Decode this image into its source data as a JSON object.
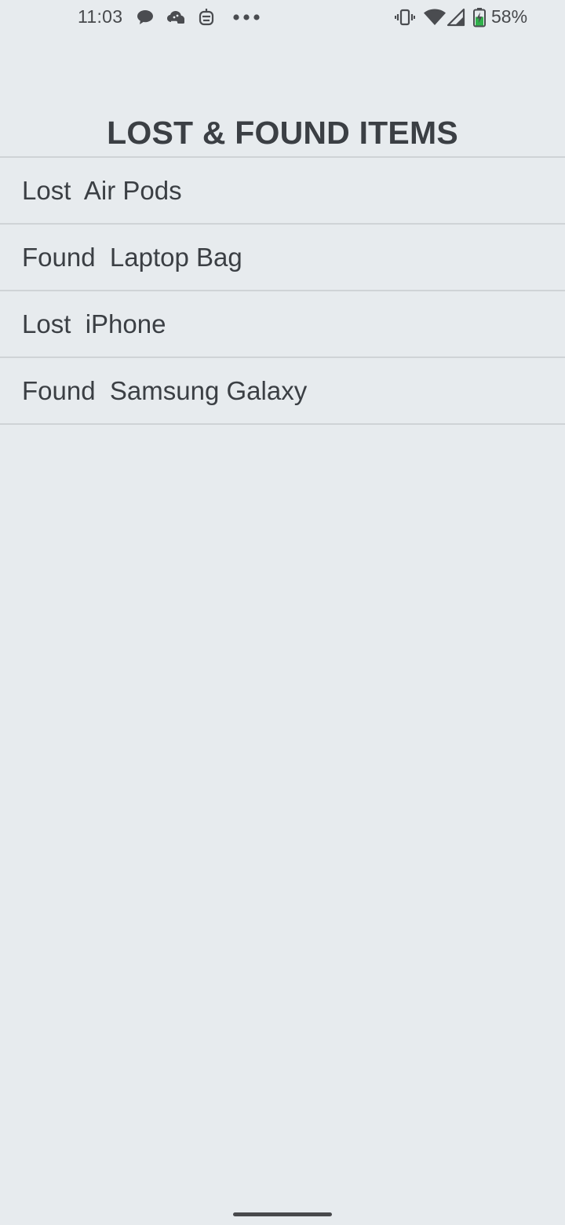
{
  "status_bar": {
    "time": "11:03",
    "battery_percent": "58%",
    "battery_level": 0.58,
    "left_icons": [
      "chat-bubble-icon",
      "cloud-message-icon",
      "robot-face-icon",
      "more-dots-icon"
    ],
    "right_icons": [
      "vibrate-icon",
      "wifi-icon",
      "cellular-signal-icon",
      "battery-charging-icon"
    ]
  },
  "page": {
    "title": "LOST & FOUND ITEMS"
  },
  "items": [
    {
      "label": "Lost  Air Pods"
    },
    {
      "label": "Found  Laptop Bag"
    },
    {
      "label": "Lost  iPhone"
    },
    {
      "label": "Found  Samsung Galaxy"
    }
  ],
  "colors": {
    "background": "#e7ebee",
    "text": "#3b3f44",
    "divider": "#cfd3d6",
    "battery_charge": "#2fb14a"
  }
}
